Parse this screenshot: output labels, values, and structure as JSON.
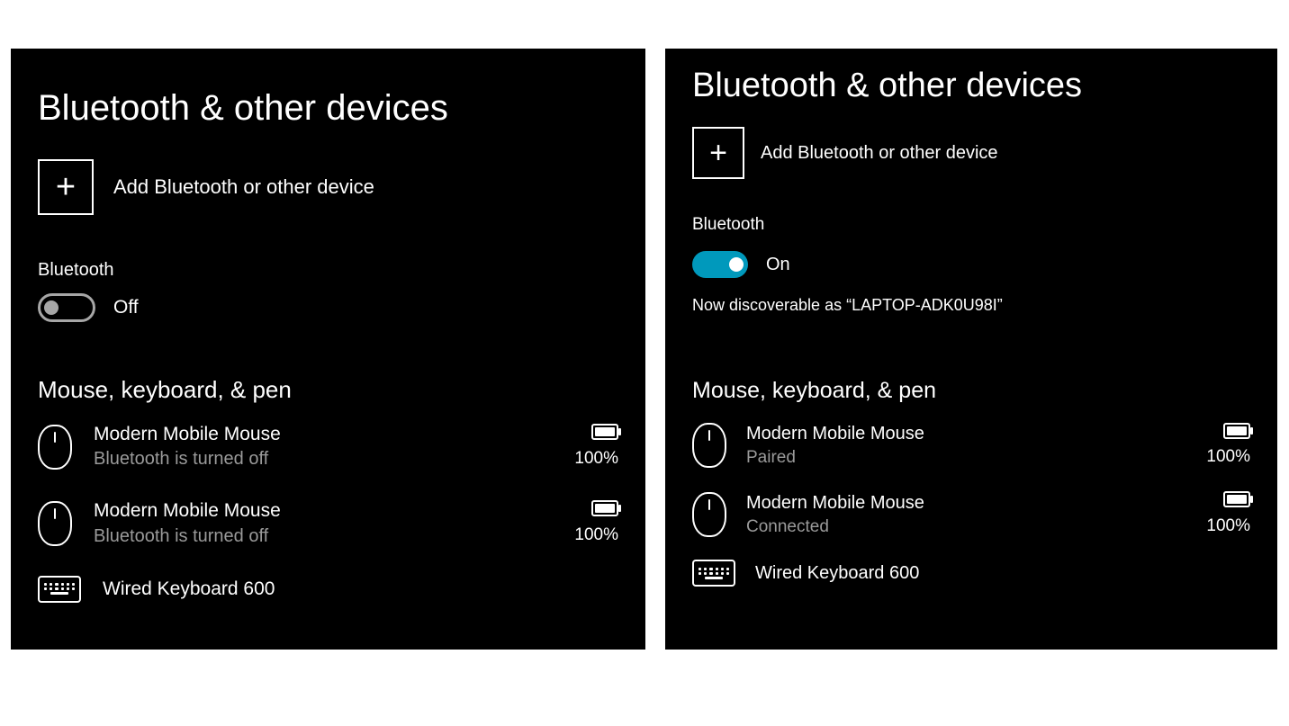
{
  "left": {
    "title": "Bluetooth & other devices",
    "add_label": "Add Bluetooth or other device",
    "bt_label": "Bluetooth",
    "toggle_state": "Off",
    "section": "Mouse, keyboard, & pen",
    "devices": [
      {
        "icon": "mouse",
        "name": "Modern Mobile Mouse",
        "status": "Bluetooth is turned off",
        "battery": "100%"
      },
      {
        "icon": "mouse",
        "name": "Modern Mobile Mouse",
        "status": "Bluetooth is turned off",
        "battery": "100%"
      },
      {
        "icon": "keyboard",
        "name": "Wired Keyboard 600"
      }
    ]
  },
  "right": {
    "title": "Bluetooth & other devices",
    "add_label": "Add Bluetooth or other device",
    "bt_label": "Bluetooth",
    "toggle_state": "On",
    "discoverable": "Now discoverable as “LAPTOP-ADK0U98I”",
    "section": "Mouse, keyboard, & pen",
    "devices": [
      {
        "icon": "mouse",
        "name": "Modern Mobile Mouse",
        "status": "Paired",
        "battery": "100%"
      },
      {
        "icon": "mouse",
        "name": "Modern Mobile Mouse",
        "status": "Connected",
        "battery": "100%"
      },
      {
        "icon": "keyboard",
        "name": "Wired Keyboard 600"
      }
    ]
  }
}
